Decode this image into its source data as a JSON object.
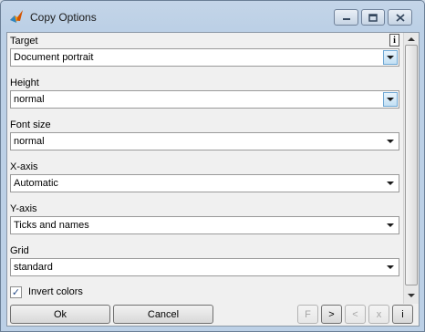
{
  "window": {
    "title": "Copy Options"
  },
  "caption": {
    "minimize_icon": "minimize-icon",
    "maximize_icon": "maximize-icon",
    "close_icon": "close-icon"
  },
  "fields": [
    {
      "label": "Target",
      "value": "Document portrait",
      "highlighted_arrow": true
    },
    {
      "label": "Height",
      "value": "normal",
      "highlighted_arrow": true
    },
    {
      "label": "Font size",
      "value": "normal",
      "highlighted_arrow": false
    },
    {
      "label": "X-axis",
      "value": "Automatic",
      "highlighted_arrow": false
    },
    {
      "label": "Y-axis",
      "value": "Ticks and names",
      "highlighted_arrow": false
    },
    {
      "label": "Grid",
      "value": "standard",
      "highlighted_arrow": false
    }
  ],
  "info_button": {
    "label": "i"
  },
  "invert_colors": {
    "label": "Invert colors",
    "checked": true,
    "check_mark": "✓"
  },
  "buttons": {
    "ok": "Ok",
    "cancel": "Cancel",
    "f": "F",
    "next": ">",
    "prev": "<",
    "x": "x",
    "info": "i"
  },
  "colors": {
    "title_bar": "#bcd0e6",
    "client_bg": "#f0f0f0",
    "arrow_highlight": "#c3e0f4"
  }
}
